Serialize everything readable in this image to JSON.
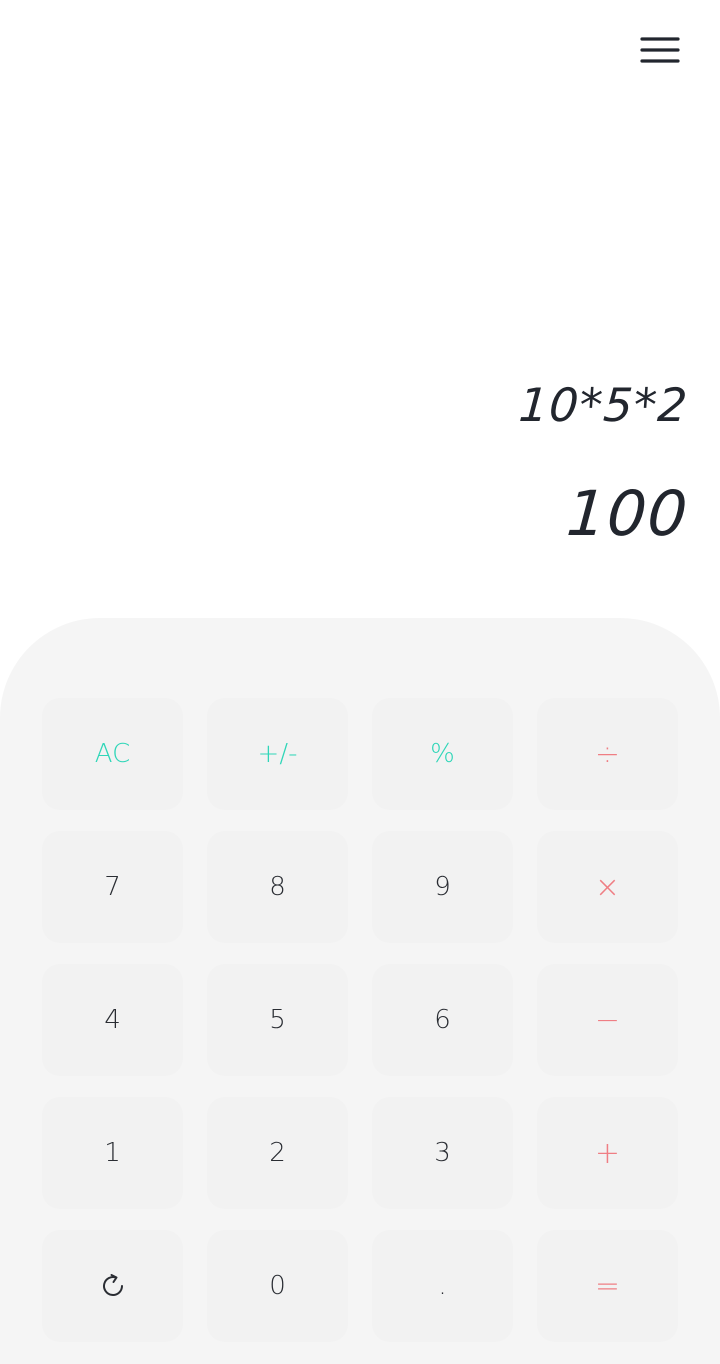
{
  "display": {
    "expression": "10*5*2",
    "result": "100"
  },
  "menu": {
    "icon": "hamburger-menu-icon"
  },
  "keys": {
    "row1": [
      "AC",
      "+/-",
      "%",
      "÷"
    ],
    "row2": [
      "7",
      "8",
      "9",
      "×"
    ],
    "row3": [
      "4",
      "5",
      "6",
      "−"
    ],
    "row4": [
      "1",
      "2",
      "3",
      "+"
    ],
    "row5": [
      "",
      "0",
      ".",
      "="
    ]
  },
  "icons": {
    "history": "refresh-icon"
  },
  "colors": {
    "function_key": "#2fd6b8",
    "operator_key": "#ef7e84",
    "digit_key": "#2a2d33",
    "key_background": "#f2f2f2",
    "keypad_background": "#f5f5f5"
  }
}
